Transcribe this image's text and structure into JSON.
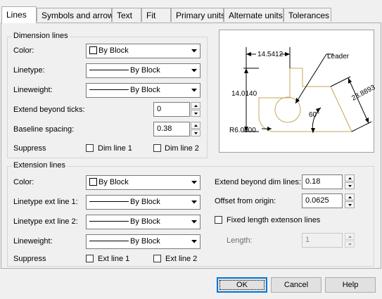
{
  "tabs": [
    "Lines",
    "Symbols and arrows",
    "Text",
    "Fit",
    "Primary units",
    "Alternate units",
    "Tolerances"
  ],
  "dimension": {
    "title": "Dimension lines",
    "color_label": "Color:",
    "color_value": "By Block",
    "linetype_label": "Linetype:",
    "linetype_value": "By Block",
    "lineweight_label": "Lineweight:",
    "lineweight_value": "By Block",
    "extend_label": "Extend beyond ticks:",
    "extend_value": "0",
    "baseline_label": "Baseline spacing:",
    "baseline_value": "0.38",
    "suppress_label": "Suppress",
    "dim1_label": "Dim line 1",
    "dim2_label": "Dim line 2"
  },
  "extension": {
    "title": "Extension lines",
    "color_label": "Color:",
    "color_value": "By Block",
    "lt1_label": "Linetype ext line 1:",
    "lt1_value": "By Block",
    "lt2_label": "Linetype ext line 2:",
    "lt2_value": "By Block",
    "lineweight_label": "Lineweight:",
    "lineweight_value": "By Block",
    "suppress_label": "Suppress",
    "ext1_label": "Ext line 1",
    "ext2_label": "Ext line 2",
    "extend_dim_label": "Extend beyond dim lines:",
    "extend_dim_value": "0.18",
    "offset_label": "Offset from origin:",
    "offset_value": "0.0625",
    "fixed_label": "Fixed length extenson lines",
    "length_label": "Length:",
    "length_value": "1"
  },
  "preview": {
    "dim_top": "14.5412",
    "dim_left": "14.0140",
    "dim_diag": "23.8893",
    "angle": "60°",
    "radius": "R6.0000",
    "leader": "Leader"
  },
  "buttons": {
    "ok": "OK",
    "cancel": "Cancel",
    "help": "Help"
  },
  "colors": {
    "geometry": "#c8a55a",
    "dimension": "#000000"
  }
}
